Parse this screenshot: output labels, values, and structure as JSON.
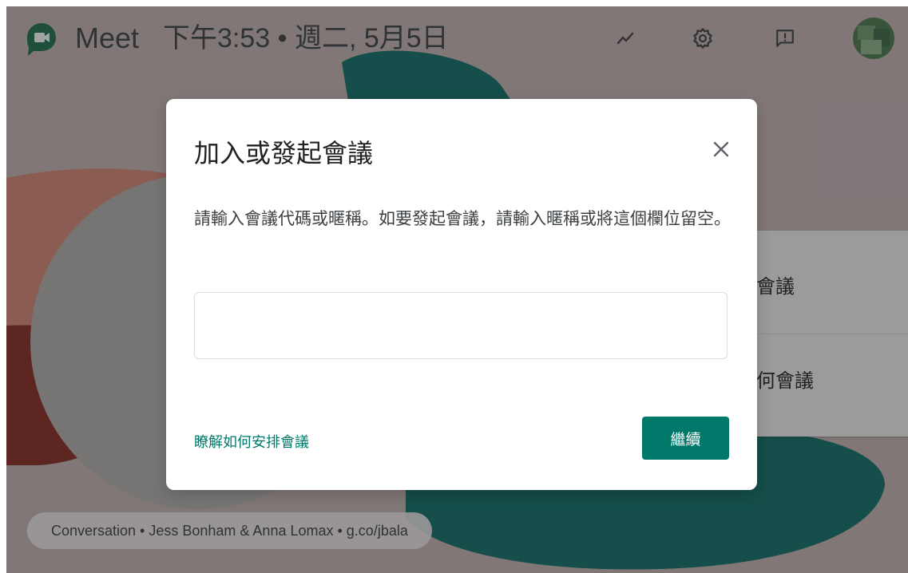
{
  "header": {
    "app_name": "Meet",
    "datetime": "下午3:53 • 週二, 5月5日",
    "icons": [
      "activity-icon",
      "gear-icon",
      "feedback-icon"
    ]
  },
  "background_list": {
    "items": [
      {
        "label": "會議"
      },
      {
        "label": "何會議"
      }
    ]
  },
  "footer": {
    "attribution": "Conversation • Jess Bonham & Anna Lomax • g.co/jbala"
  },
  "dialog": {
    "title": "加入或發起會議",
    "description": "請輸入會議代碼或暱稱。如要發起會議，請輸入暱稱或將這個欄位留空。",
    "input_value": "",
    "input_placeholder": "",
    "learn_link": "瞭解如何安排會議",
    "continue_label": "繼續"
  },
  "colors": {
    "accent": "#00796b",
    "scrim": "#202124",
    "art_teal": "#0e6f66",
    "art_red": "#8a2a20"
  }
}
